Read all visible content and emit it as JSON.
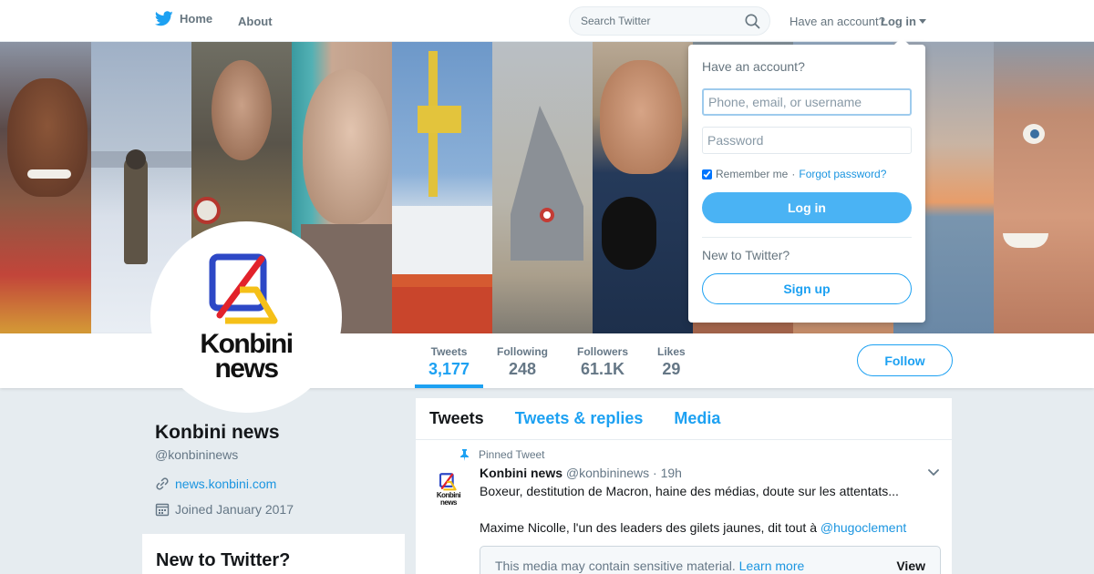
{
  "nav": {
    "home_label": "Home",
    "about_label": "About",
    "search_placeholder": "Search Twitter",
    "have_account": "Have an account?",
    "login_label": "Log in"
  },
  "profile": {
    "avatar_line1": "Konbini",
    "avatar_line2": "news",
    "name": "Konbini news",
    "handle": "@konbininews",
    "url": "news.konbini.com",
    "joined": "Joined January 2017"
  },
  "stats": [
    {
      "label": "Tweets",
      "value": "3,177"
    },
    {
      "label": "Following",
      "value": "248"
    },
    {
      "label": "Followers",
      "value": "61.1K"
    },
    {
      "label": "Likes",
      "value": "29"
    }
  ],
  "follow_label": "Follow",
  "sidebar": {
    "new_to_twitter_heading": "New to Twitter?"
  },
  "timeline": {
    "tabs": [
      "Tweets",
      "Tweets & replies",
      "Media"
    ],
    "tweet": {
      "pinned_label": "Pinned Tweet",
      "avatar_line1": "Konbini",
      "avatar_line2": "news",
      "name": "Konbini news",
      "handle": "@konbininews",
      "separator": "·",
      "time": "19h",
      "text1": "Boxeur, destitution de Macron, haine des médias, doute sur les attentats...",
      "text2_prefix": "Maxime Nicolle, l'un des leaders des gilets jaunes, dit tout à ",
      "mention": "@hugoclement",
      "sensitive_text": "This media may contain sensitive material.",
      "learn_more": "Learn more",
      "view_label": "View"
    }
  },
  "login_dropdown": {
    "title": "Have an account?",
    "username_placeholder": "Phone, email, or username",
    "password_placeholder": "Password",
    "remember_label": "Remember me",
    "separator": "·",
    "forgot_label": "Forgot password?",
    "login_button": "Log in",
    "new_label": "New to Twitter?",
    "signup_button": "Sign up"
  },
  "colors": {
    "accent": "#1da1f2",
    "link": "#1b95e0",
    "background": "#e6ecf0"
  }
}
